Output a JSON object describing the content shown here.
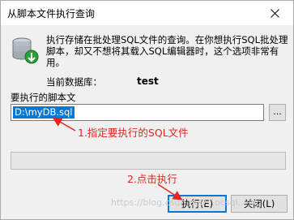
{
  "window": {
    "title": "从脚本文件执行查询"
  },
  "description": "执行存储在批处理SQL文件的查询。在你想执行SQL批处理脚本，却又不想将其载入SQL编辑器时，这个选项非常有用。",
  "current_db": {
    "label": "当前数据库：",
    "value": "test"
  },
  "script": {
    "label": "要执行的脚本文",
    "path": "D:\\myDB.sql",
    "browse_label": "..."
  },
  "buttons": {
    "execute_label": "执行(E)",
    "close_label": "关闭(L)"
  },
  "annotations": {
    "step1": "1.指定要执行的SQL文件",
    "step2": "2.点击执行",
    "color": "#e8251f"
  },
  "icons": {
    "database": "database-run-icon",
    "close": "close-icon"
  },
  "watermark": "https://blog.csdn.net/...ocsql...sxc"
}
